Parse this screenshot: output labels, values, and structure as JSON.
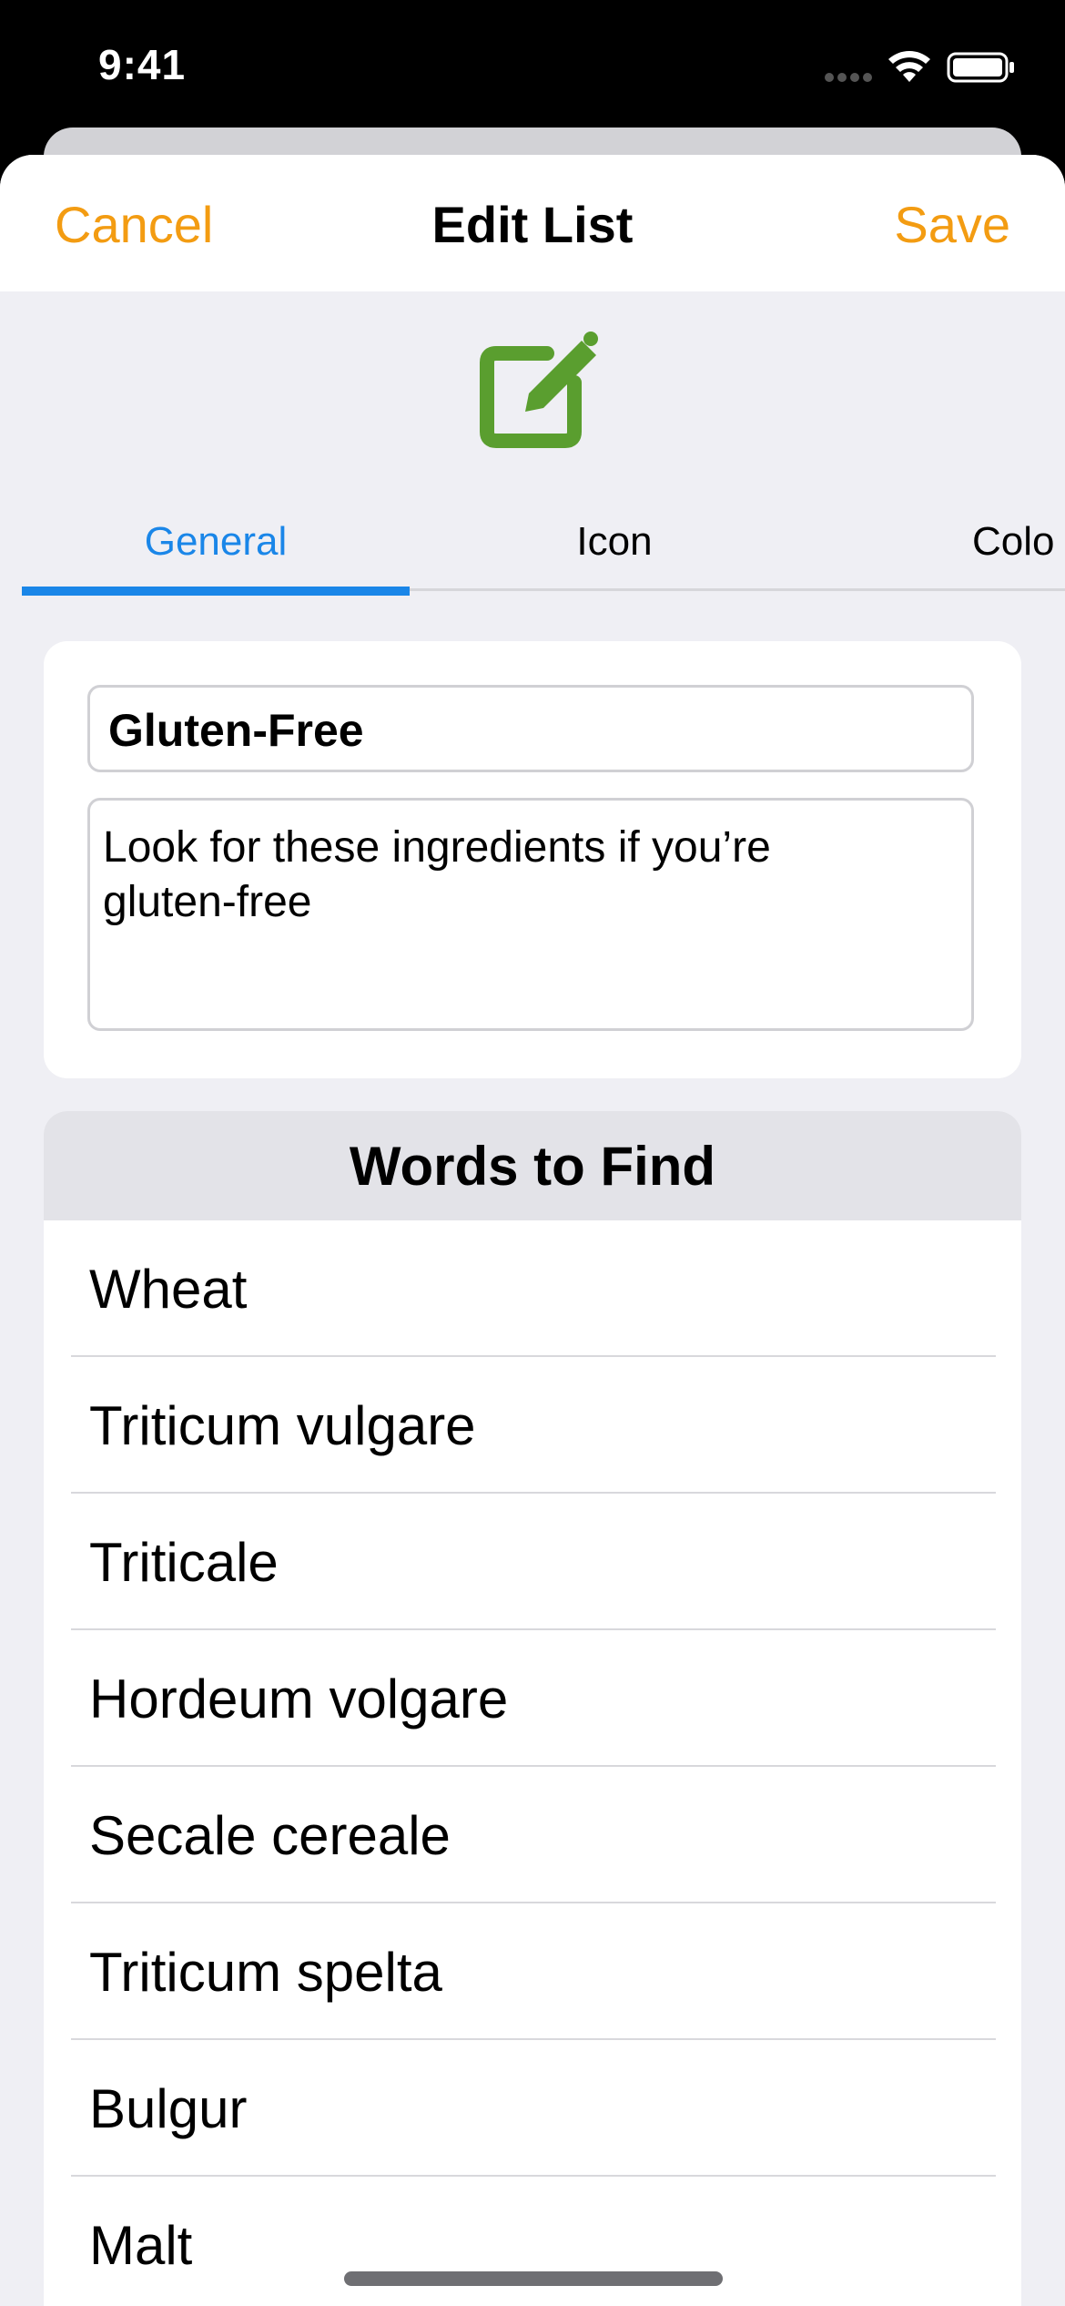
{
  "status_bar": {
    "time": "9:41",
    "icons": [
      "signal-dots-icon",
      "wifi-icon",
      "battery-icon"
    ]
  },
  "nav": {
    "cancel_label": "Cancel",
    "title": "Edit List",
    "save_label": "Save"
  },
  "header_icon": {
    "name": "edit-square-icon",
    "color": "#5a9e2f"
  },
  "tabs": [
    {
      "label": "General",
      "selected": true
    },
    {
      "label": "Icon",
      "selected": false
    },
    {
      "label": "Colo",
      "selected": false
    }
  ],
  "general": {
    "name_value": "Gluten-Free",
    "description_lines": [
      "Look for these ingredients if you’re",
      "gluten-free"
    ]
  },
  "words": {
    "header": "Words to Find",
    "items": [
      "Wheat",
      "Triticum vulgare",
      "Triticale",
      "Hordeum volgare",
      "Secale cereale",
      "Triticum spelta",
      "Bulgur",
      "Malt"
    ]
  },
  "colors": {
    "accent_orange": "#f39c12",
    "tab_blue": "#1a86e8",
    "background": "#efeff4"
  }
}
